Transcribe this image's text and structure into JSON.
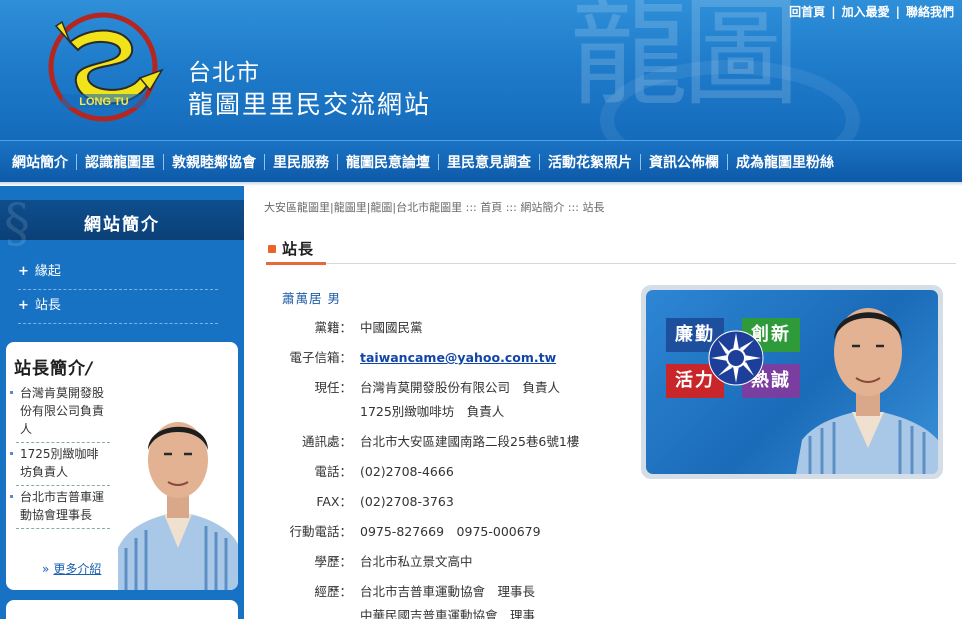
{
  "header": {
    "logo_text": "LONG TU",
    "watermark": "龍圖",
    "title_line1": "台北市",
    "title_line2": "龍圖里里民交流網站",
    "toplinks": [
      "回首頁",
      "加入最愛",
      "聯絡我們"
    ]
  },
  "nav": {
    "items": [
      "網站簡介",
      "認識龍圖里",
      "敦親睦鄰協會",
      "里民服務",
      "龍圖民意論壇",
      "里民意見調查",
      "活動花絮照片",
      "資訊公佈欄",
      "成為龍圖里粉絲"
    ]
  },
  "sidebar": {
    "title": "網站簡介",
    "menu": [
      "緣起",
      "站長"
    ],
    "profile": {
      "title": "站長簡介",
      "items": [
        "台灣肯莫開發股份有限公司負責人",
        "1725別緻咖啡坊負責人",
        "台北市吉普車運動協會理事長"
      ],
      "more_label": "更多介紹"
    }
  },
  "main": {
    "breadcrumb": "大安區龍圖里|龍圖里|龍圖|台北市龍圖里 ::: 首頁 ::: 網站簡介 ::: 站長",
    "heading": "站長",
    "name": "蕭萬居 男",
    "fields": [
      {
        "label": "黨籍：",
        "value": [
          "中國國民黨"
        ]
      },
      {
        "label": "電子信箱：",
        "value": [
          "taiwancame@yahoo.com.tw"
        ],
        "link": true
      },
      {
        "label": "現任：",
        "value": [
          "台灣肯莫開發股份有限公司　負責人",
          "1725別緻咖啡坊　負責人"
        ]
      },
      {
        "label": "通訊處：",
        "value": [
          "台北市大安區建國南路二段25巷6號1樓"
        ]
      },
      {
        "label": "電話：",
        "value": [
          "(02)2708-4666"
        ]
      },
      {
        "label": "FAX：",
        "value": [
          "(02)2708-3763"
        ]
      },
      {
        "label": "行動電話：",
        "value": [
          "0975-827669　0975-000679"
        ]
      },
      {
        "label": "學歷：",
        "value": [
          "台北市私立景文高中"
        ]
      },
      {
        "label": "經歷：",
        "value": [
          "台北市吉普車運動協會　理事長",
          "中華民國吉普車運動協會　理事"
        ]
      }
    ],
    "photo_keywords": [
      "廉勤",
      "創新",
      "活力",
      "熱誠"
    ]
  },
  "colors": {
    "header_blue": "#1f7ccb",
    "nav_blue": "#0d5aa8",
    "accent_orange": "#e36a3a",
    "link_blue": "#1245a8"
  }
}
